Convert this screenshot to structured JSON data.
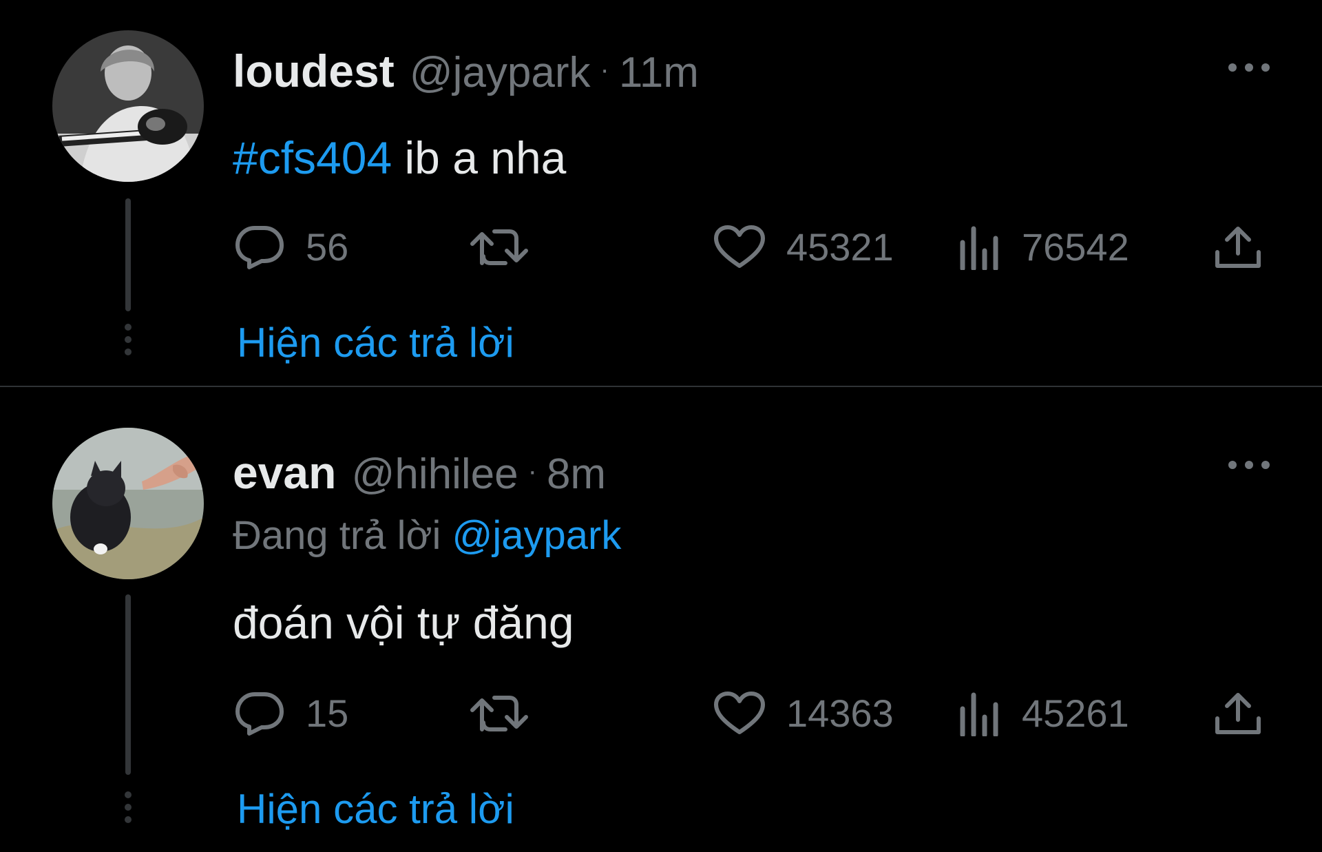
{
  "tweets": [
    {
      "display_name": "loudest",
      "handle": "@jaypark",
      "separator": "·",
      "time": "11m",
      "hashtag": "#cfs404",
      "text": " ib a nha",
      "replies": "56",
      "likes": "45321",
      "views": "76542",
      "show_replies": "Hiện các trả lời"
    },
    {
      "display_name": "evan",
      "handle": "@hihilee",
      "separator": "·",
      "time": "8m",
      "replying_label": "Đang trả lời ",
      "replying_to": "@jaypark",
      "text": "đoán vội tự đăng",
      "replies": "15",
      "likes": "14363",
      "views": "45261",
      "show_replies": "Hiện các trả lời"
    }
  ],
  "colors": {
    "background": "#000000",
    "primary_text": "#e7e9ea",
    "secondary_text": "#71767b",
    "accent": "#1d9bf0",
    "divider": "#2f3336"
  },
  "icons": [
    "reply-icon",
    "retweet-icon",
    "like-icon",
    "views-icon",
    "share-icon",
    "more-icon"
  ]
}
